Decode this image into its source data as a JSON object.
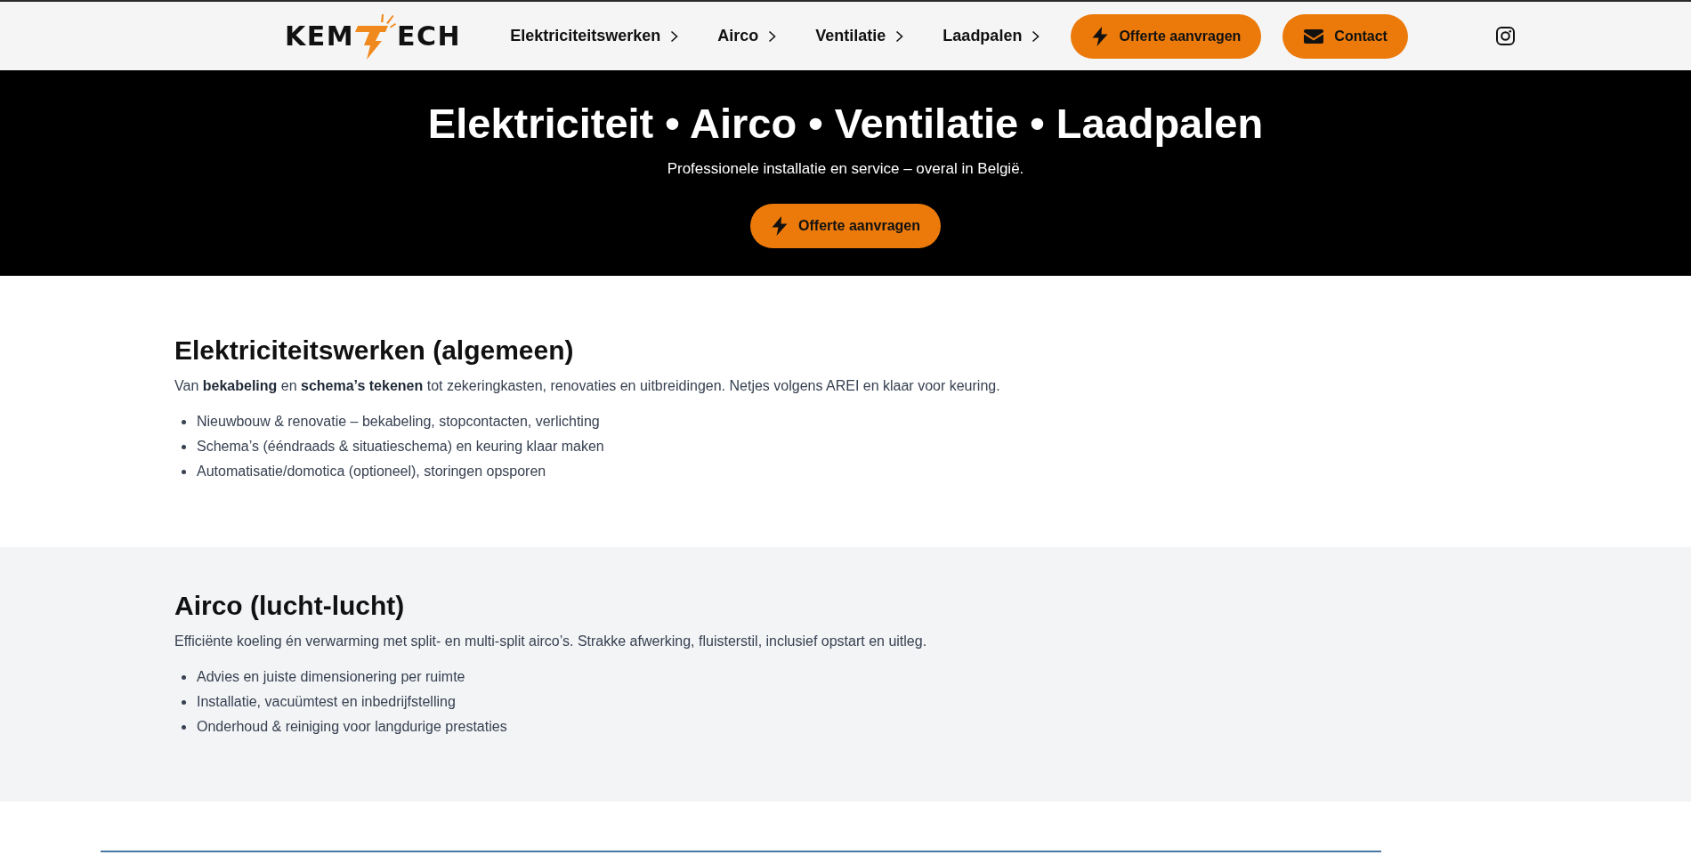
{
  "header": {
    "logo": {
      "text_before": "KEM",
      "text_after": "ECH"
    },
    "nav": [
      {
        "label": "Elektriciteitswerken",
        "expanded": false
      },
      {
        "label": "Airco",
        "expanded": false
      },
      {
        "label": "Ventilatie",
        "expanded": false
      },
      {
        "label": "Laadpalen",
        "expanded": false
      }
    ],
    "buttons": [
      {
        "label": "Offerte aanvragen",
        "kind": "quote"
      },
      {
        "label": "Contact",
        "kind": "contact"
      }
    ],
    "social_links": [
      {
        "kind": "instagram"
      }
    ]
  },
  "hero": {
    "title": "Elektriciteit • Airco • Ventilatie • Laadpalen",
    "subtitle": "Professionele installatie en service – overal in België.",
    "button": {
      "label": "Offerte aanvragen",
      "kind": "quote"
    }
  },
  "sections": [
    {
      "title": "Elektriciteitswerken (algemeen)",
      "shaded": false,
      "intro": "Van **bekabeling** en **schema’s tekenen** tot zekeringkasten, renovaties en uitbreidingen. Netjes volgens AREI en klaar voor keuring.",
      "bullets": [
        "Nieuwbouw & renovatie – bekabeling, stopcontacten, verlichting",
        "Schema’s (ééndraads & situatieschema) en keuring klaar maken",
        "Automatisatie/domotica (optioneel), storingen opsporen"
      ]
    },
    {
      "title": "Airco (lucht-lucht)",
      "shaded": true,
      "intro": "Efficiënte koeling én verwarming met split- en multi-split airco’s. Strakke afwerking, fluisterstil, inclusief opstart en uitleg.",
      "bullets": [
        "Advies en juiste dimensionering per ruimte",
        "Installatie, vacuümtest en inbedrijfstelling",
        "Onderhoud & reiniging voor langdurige prestaties"
      ]
    }
  ]
}
